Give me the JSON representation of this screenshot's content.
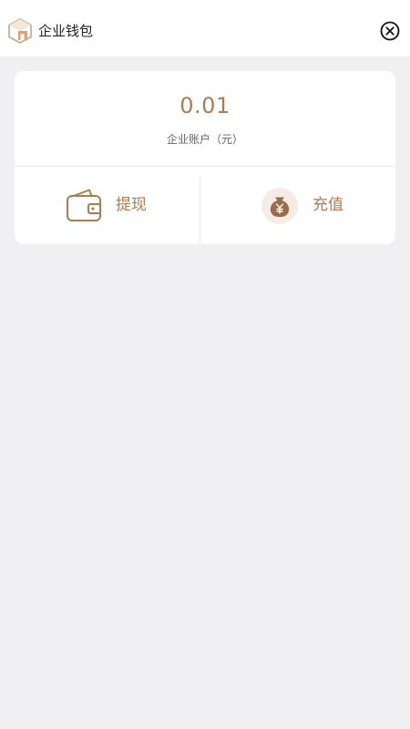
{
  "header": {
    "title": "企业钱包",
    "logo_icon": "store-logo-icon",
    "close_icon": "close-circle-icon"
  },
  "account": {
    "balance": "0.01",
    "label": "企业账户（元）"
  },
  "actions": {
    "withdraw_label": "提现",
    "withdraw_icon": "wallet-icon",
    "recharge_label": "充值",
    "recharge_icon": "money-bag-yen-icon"
  },
  "colors": {
    "accent": "#b07a52",
    "page_background": "#f0eff2",
    "card_background": "#ffffff"
  }
}
